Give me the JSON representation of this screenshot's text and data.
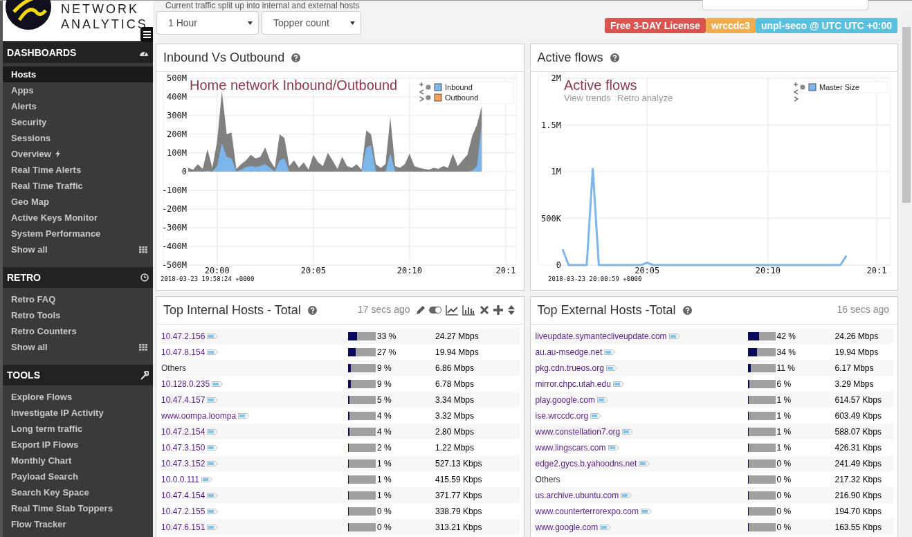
{
  "header": {
    "subtitle": "Current traffic split up into internal and external hosts",
    "brand_top": "NETWORK",
    "brand": "ANALYTICS"
  },
  "selects": [
    {
      "value": "1 Hour"
    },
    {
      "value": "Topper count"
    }
  ],
  "badges": [
    {
      "text": "Free 3-DAY License",
      "color": "#d9534f"
    },
    {
      "text": "wrccdc3",
      "color": "#f0ad4e"
    },
    {
      "text": "unpl-seco @ UTC UTC +0:00",
      "color": "#5bc0de"
    }
  ],
  "sidebar": [
    {
      "title": "DASHBOARDS",
      "items": [
        {
          "label": "Hosts",
          "selected": true,
          "kind": "plain"
        },
        {
          "label": "Apps",
          "selected": false,
          "kind": "plain"
        },
        {
          "label": "Alerts",
          "selected": false,
          "kind": "plain"
        },
        {
          "label": "Security",
          "selected": false,
          "kind": "plain"
        },
        {
          "label": "Sessions",
          "selected": false,
          "kind": "plain"
        },
        {
          "label": "Overview",
          "selected": false,
          "kind": "flash"
        },
        {
          "label": "Real Time Alerts",
          "selected": false,
          "kind": "plain"
        },
        {
          "label": "Real Time Traffic",
          "selected": false,
          "kind": "plain"
        },
        {
          "label": "Geo Map",
          "selected": false,
          "kind": "plain"
        },
        {
          "label": "Active Keys Monitor",
          "selected": false,
          "kind": "plain"
        },
        {
          "label": "System Performance",
          "selected": false,
          "kind": "plain"
        },
        {
          "label": "Show all",
          "selected": false,
          "kind": "grid"
        }
      ]
    },
    {
      "title": "RETRO",
      "items": [
        {
          "label": "Retro FAQ",
          "selected": false,
          "kind": "plain"
        },
        {
          "label": "Retro Tools",
          "selected": false,
          "kind": "plain"
        },
        {
          "label": "Retro Counters",
          "selected": false,
          "kind": "plain"
        },
        {
          "label": "Show all",
          "selected": false,
          "kind": "grid"
        }
      ]
    },
    {
      "title": "TOOLS",
      "items": [
        {
          "label": "Explore Flows",
          "selected": false,
          "kind": "plain"
        },
        {
          "label": "Investigate IP Activity",
          "selected": false,
          "kind": "plain"
        },
        {
          "label": "Long term traffic",
          "selected": false,
          "kind": "plain"
        },
        {
          "label": "Export IP Flows",
          "selected": false,
          "kind": "plain"
        },
        {
          "label": "Monthly Chart",
          "selected": false,
          "kind": "plain"
        },
        {
          "label": "Payload Search",
          "selected": false,
          "kind": "plain"
        },
        {
          "label": "Search Key Space",
          "selected": false,
          "kind": "plain"
        },
        {
          "label": "Real Time Stab Toppers",
          "selected": false,
          "kind": "plain"
        },
        {
          "label": "Flow Tracker",
          "selected": false,
          "kind": "plain"
        }
      ]
    }
  ],
  "charts": [
    {
      "title": "Inbound Vs Outbound",
      "kind": "traffic",
      "timestamp": "2018-03-23 19:58:24 +0000",
      "legend": [
        {
          "color": "#7cb5ec"
        },
        {
          "color": "#f7a35c"
        }
      ],
      "chart_data": {
        "type": "area",
        "title": "Home network Inbound/Outbound",
        "grid": true,
        "ylim": [
          -500,
          500
        ],
        "categories": [
          null,
          null,
          null,
          null,
          null,
          null,
          "20:00",
          null,
          null,
          null,
          null,
          null,
          null,
          null,
          null,
          null,
          null,
          null,
          null,
          null,
          null,
          null,
          null,
          null,
          null,
          null,
          "20:05",
          null,
          null,
          null,
          null,
          null,
          null,
          null,
          null,
          null,
          null,
          null,
          null,
          null,
          null,
          null,
          null,
          null,
          null,
          null,
          "20:10",
          null,
          null,
          null,
          null,
          null,
          null,
          null,
          null,
          null,
          null,
          null,
          null,
          null,
          null,
          null,
          null,
          null,
          null,
          null,
          "20:1"
        ],
        "series": [
          {
            "name": "Inbound",
            "color": "#7cb5ec",
            "values": [
              0,
              0,
              2,
              0,
              5,
              0,
              30,
              150,
              80,
              70,
              0,
              10,
              25,
              30,
              25,
              30,
              40,
              20,
              0,
              60,
              70,
              0,
              0,
              0,
              0,
              0,
              0,
              0,
              0,
              0,
              0,
              0,
              0,
              0,
              0,
              0,
              0,
              130,
              140,
              0,
              0,
              0,
              100,
              0,
              0,
              0,
              0,
              0,
              0,
              0,
              0,
              0,
              0,
              0,
              0,
              0,
              0,
              0,
              0,
              5,
              30,
              260,
              null,
              null,
              null,
              null,
              null
            ]
          },
          {
            "name": "Outbound",
            "color": "#808080",
            "values": [
              20,
              10,
              40,
              15,
              120,
              20,
              160,
              430,
              200,
              210,
              15,
              40,
              60,
              90,
              70,
              80,
              130,
              60,
              20,
              200,
              180,
              30,
              60,
              20,
              50,
              10,
              90,
              50,
              30,
              100,
              60,
              15,
              80,
              30,
              20,
              40,
              10,
              220,
              200,
              40,
              20,
              40,
              290,
              30,
              20,
              40,
              95,
              30,
              20,
              15,
              10,
              20,
              15,
              30,
              20,
              95,
              30,
              60,
              90,
              190,
              250,
              350,
              null,
              null,
              null,
              null,
              null
            ]
          }
        ],
        "yticks": [
          {
            "value": 500,
            "label": "500M"
          },
          {
            "value": 400,
            "label": "400M"
          },
          {
            "value": 300,
            "label": "300M"
          },
          {
            "value": 200,
            "label": "200M"
          },
          {
            "value": 100,
            "label": "100M"
          },
          {
            "value": 0,
            "label": "0"
          },
          {
            "value": -100,
            "label": "-100M"
          },
          {
            "value": -200,
            "label": "-200M"
          },
          {
            "value": -300,
            "label": "-300M"
          },
          {
            "value": -400,
            "label": "-400M"
          },
          {
            "value": -500,
            "label": "-500M"
          }
        ]
      }
    },
    {
      "title": "Active flows",
      "kind": "flows",
      "links": [
        "View trends",
        "Retro analyze"
      ],
      "timestamp": "2018-03-23 20:00:59 +0000",
      "legend": [
        {
          "color": "#7cb5ec"
        }
      ],
      "chart_data": {
        "type": "line",
        "title": "Active flows",
        "grid": true,
        "ylim": [
          0,
          2000000
        ],
        "categories": [
          null,
          null,
          null,
          null,
          null,
          null,
          null,
          null,
          null,
          null,
          null,
          null,
          null,
          null,
          "20:05",
          null,
          null,
          null,
          null,
          null,
          null,
          null,
          null,
          null,
          null,
          null,
          null,
          null,
          null,
          null,
          null,
          null,
          null,
          null,
          "20:10",
          null,
          null,
          null,
          null,
          null,
          null,
          null,
          null,
          null,
          null,
          null,
          null,
          null,
          null,
          null,
          null,
          null,
          "20:1"
        ],
        "series": [
          {
            "name": "Master Size",
            "color": "#7cb5ec",
            "values": [
              170000,
              0,
              0,
              0,
              0,
              1030000,
              0,
              0,
              0,
              0,
              0,
              0,
              0,
              0,
              25000,
              0,
              0,
              0,
              0,
              0,
              0,
              0,
              0,
              0,
              0,
              0,
              0,
              0,
              0,
              0,
              0,
              0,
              0,
              0,
              0,
              0,
              0,
              0,
              0,
              0,
              0,
              0,
              0,
              0,
              0,
              0,
              0,
              100000,
              null,
              null,
              null,
              null,
              null
            ]
          }
        ],
        "yticks": [
          {
            "value": 2000000,
            "label": "2M"
          },
          {
            "value": 1500000,
            "label": "1.5M"
          },
          {
            "value": 1000000,
            "label": "1M"
          },
          {
            "value": 500000,
            "label": "500K"
          },
          {
            "value": 0,
            "label": "0"
          }
        ]
      }
    }
  ],
  "tables": [
    {
      "title": "Top Internal Hosts - Total",
      "updated": "17 secs ago",
      "toolbar": true,
      "rows": [
        {
          "host": "10.47.2.156",
          "kind": "link",
          "level": 0.33,
          "percent": "33 %",
          "rate": "24.27 Mbps"
        },
        {
          "host": "10.47.8.154",
          "kind": "link",
          "level": 0.27,
          "percent": "27 %",
          "rate": "19.94 Mbps"
        },
        {
          "host": "Others",
          "kind": "plain",
          "level": 0.09,
          "percent": "9 %",
          "rate": "6.86 Mbps"
        },
        {
          "host": "10.128.0.235",
          "kind": "link",
          "level": 0.09,
          "percent": "9 %",
          "rate": "6.78 Mbps"
        },
        {
          "host": "10.47.4.157",
          "kind": "link",
          "level": 0.05,
          "percent": "5 %",
          "rate": "3.34 Mbps"
        },
        {
          "host": "www.oompa.loompa",
          "kind": "link",
          "level": 0.04,
          "percent": "4 %",
          "rate": "3.32 Mbps"
        },
        {
          "host": "10.47.2.154",
          "kind": "link",
          "level": 0.04,
          "percent": "4 %",
          "rate": "2.80 Mbps"
        },
        {
          "host": "10.47.3.150",
          "kind": "link",
          "level": 0.02,
          "percent": "2 %",
          "rate": "1.22 Mbps"
        },
        {
          "host": "10.47.3.152",
          "kind": "link",
          "level": 0.01,
          "percent": "1 %",
          "rate": "527.13 Kbps"
        },
        {
          "host": "10.0.0.111",
          "kind": "link",
          "level": 0.01,
          "percent": "1 %",
          "rate": "415.59 Kbps"
        },
        {
          "host": "10.47.4.154",
          "kind": "link",
          "level": 0.01,
          "percent": "1 %",
          "rate": "371.77 Kbps"
        },
        {
          "host": "10.47.2.155",
          "kind": "link",
          "level": 0,
          "percent": "0 %",
          "rate": "338.79 Kbps"
        },
        {
          "host": "10.47.6.151",
          "kind": "link",
          "level": 0,
          "percent": "0 %",
          "rate": "313.21 Kbps"
        }
      ]
    },
    {
      "title": "Top External Hosts -Total",
      "updated": "16 secs ago",
      "toolbar": false,
      "rows": [
        {
          "host": "liveupdate.symantecliveupdate.com",
          "kind": "link",
          "level": 0.42,
          "percent": "42 %",
          "rate": "24.26 Mbps"
        },
        {
          "host": "au.au-msedge.net",
          "kind": "link",
          "level": 0.34,
          "percent": "34 %",
          "rate": "19.94 Mbps"
        },
        {
          "host": "pkg.cdn.trueos.org",
          "kind": "link",
          "level": 0.11,
          "percent": "11 %",
          "rate": "6.17 Mbps"
        },
        {
          "host": "mirror.chpc.utah.edu",
          "kind": "link",
          "level": 0.06,
          "percent": "6 %",
          "rate": "3.29 Mbps"
        },
        {
          "host": "play.google.com",
          "kind": "link",
          "level": 0.01,
          "percent": "1 %",
          "rate": "614.57 Kbps"
        },
        {
          "host": "ise.wrccdc.org",
          "kind": "link",
          "level": 0.01,
          "percent": "1 %",
          "rate": "603.49 Kbps"
        },
        {
          "host": "www.constellation7.org",
          "kind": "link",
          "level": 0.01,
          "percent": "1 %",
          "rate": "588.07 Kbps"
        },
        {
          "host": "www.lingscars.com",
          "kind": "link",
          "level": 0.01,
          "percent": "1 %",
          "rate": "426.31 Kbps"
        },
        {
          "host": "edge2.gycs.b.yahoodns.net",
          "kind": "link",
          "level": 0,
          "percent": "0 %",
          "rate": "241.49 Kbps"
        },
        {
          "host": "Others",
          "kind": "plain",
          "level": 0,
          "percent": "0 %",
          "rate": "217.32 Kbps"
        },
        {
          "host": "us.archive.ubuntu.com",
          "kind": "link",
          "level": 0,
          "percent": "0 %",
          "rate": "216.90 Kbps"
        },
        {
          "host": "www.counterterrorexpo.com",
          "kind": "link",
          "level": 0,
          "percent": "0 %",
          "rate": "194.70 Kbps"
        },
        {
          "host": "www.google.com",
          "kind": "link",
          "level": 0,
          "percent": "0 %",
          "rate": "163.55 Kbps"
        }
      ]
    }
  ]
}
